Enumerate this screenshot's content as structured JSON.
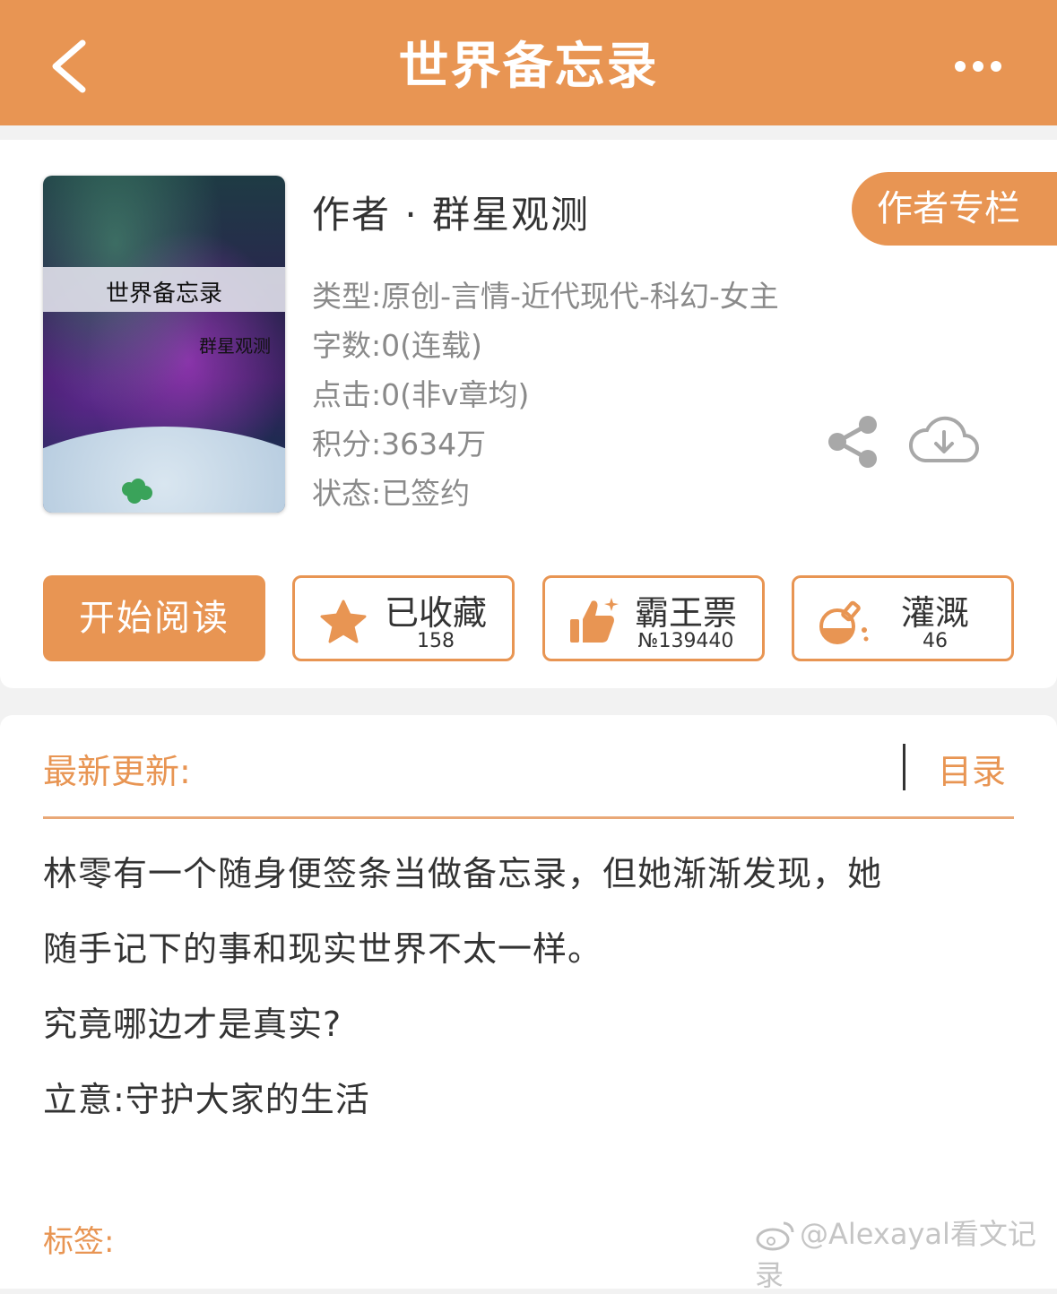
{
  "header": {
    "title": "世界备忘录",
    "back_icon": "chevron-left-icon",
    "more_icon": "more-dots-icon"
  },
  "book": {
    "cover_title": "世界备忘录",
    "cover_author": "群星观测",
    "author_line": "作者 · 群星观测",
    "column_button": "作者专栏",
    "type": "类型:原创-言情-近代现代-科幻-女主",
    "word_count": "字数:0(连载)",
    "clicks": "点击:0(非v章均)",
    "score": "积分:3634万",
    "status": "状态:已签约"
  },
  "actions": {
    "read_label": "开始阅读",
    "favorite": {
      "label": "已收藏",
      "count": "158",
      "icon": "star-icon"
    },
    "vote": {
      "label": "霸王票",
      "count": "№139440",
      "icon": "thumbs-up-icon"
    },
    "nutrient": {
      "label": "灌溉",
      "count": "46",
      "icon": "flask-icon"
    }
  },
  "section": {
    "latest_label": "最新更新:",
    "toc_label": "目录",
    "description": [
      "林零有一个随身便签条当做备忘录，但她渐渐发现，她",
      "随手记下的事和现实世界不太一样。",
      "究竟哪边才是真实?",
      "立意:守护大家的生活"
    ],
    "tags_label": "标签:"
  },
  "watermark": "@Alexayal看文记录",
  "colors": {
    "accent": "#e89553",
    "text": "#333333",
    "meta": "#8a8a8a"
  }
}
